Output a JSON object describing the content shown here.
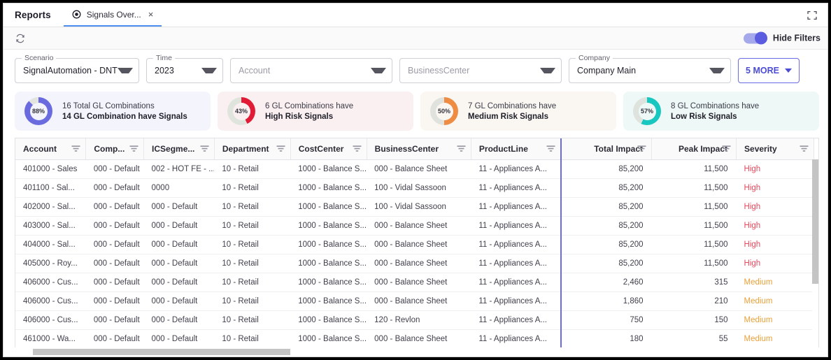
{
  "header": {
    "reports_title": "Reports",
    "tab_label": "Signals Over...",
    "tab_icon": "signal-dot-icon",
    "tab_close": "×",
    "expand_icon": "expand-fullscreen-icon"
  },
  "toolbar": {
    "refresh_icon": "refresh-icon",
    "hide_filters_label": "Hide Filters",
    "toggle_state": "on"
  },
  "filters": [
    {
      "legend": "Scenario",
      "value": "SignalAutomation - DNT",
      "placeholder": ""
    },
    {
      "legend": "Time",
      "value": "2023",
      "placeholder": ""
    },
    {
      "legend": "",
      "value": "",
      "placeholder": "Account"
    },
    {
      "legend": "",
      "value": "",
      "placeholder": "BusinessCenter"
    },
    {
      "legend": "Company",
      "value": "Company Main",
      "placeholder": ""
    }
  ],
  "more_button": {
    "label": "5 MORE"
  },
  "kpis": [
    {
      "percent": "88%",
      "pct_value": 88,
      "line1": "16 Total GL Combinations",
      "line2": "14 GL Combination have Signals",
      "bg": "#f4f4fd",
      "ring": "#6b6be0",
      "track": "#e2e4e0"
    },
    {
      "percent": "43%",
      "pct_value": 43,
      "line1": "6 GL Combinations have",
      "line2": "High Risk Signals",
      "bg": "#fbf0f1",
      "ring": "#e11b35",
      "track": "#dfe5dd"
    },
    {
      "percent": "50%",
      "pct_value": 50,
      "line1": "7 GL Combinations have",
      "line2": "Medium Risk Signals",
      "bg": "#faf7f2",
      "ring": "#ef8c43",
      "track": "#e0e3dd"
    },
    {
      "percent": "57%",
      "pct_value": 57,
      "line1": "8 GL Combinations have",
      "line2": "Low Risk Signals",
      "bg": "#eef8f7",
      "ring": "#17c7c0",
      "track": "#dfe3de"
    }
  ],
  "table": {
    "columns": [
      {
        "label": "Account",
        "align": "left",
        "width": 100
      },
      {
        "label": "Comp...",
        "align": "left",
        "width": 82
      },
      {
        "label": "ICSegme...",
        "align": "left",
        "width": 100
      },
      {
        "label": "Department",
        "align": "left",
        "width": 108
      },
      {
        "label": "CostCenter",
        "align": "left",
        "width": 108
      },
      {
        "label": "BusinessCenter",
        "align": "left",
        "width": 148
      },
      {
        "label": "ProductLine",
        "align": "left",
        "width": 128
      },
      {
        "label": "Total Impact",
        "align": "right",
        "width": 128
      },
      {
        "label": "Peak Impact",
        "align": "right",
        "width": 120
      },
      {
        "label": "Severity",
        "align": "left",
        "width": 110
      }
    ],
    "rows": [
      [
        "401000 - Sales",
        "000 - Default",
        "002 - HOT FE - ...",
        "10 - Retail",
        "1000 - Balance S...",
        "000 - Balance Sheet",
        "11 - Appliances A...",
        "85,200",
        "11,500",
        "High"
      ],
      [
        "401100 - Sal...",
        "000 - Default",
        "0000",
        "10 - Retail",
        "1000 - Balance S...",
        "100 - Vidal Sassoon",
        "11 - Appliances A...",
        "85,200",
        "11,500",
        "High"
      ],
      [
        "402000 - Sal...",
        "000 - Default",
        "000 - Default",
        "10 - Retail",
        "1000 - Balance S...",
        "100 - Vidal Sassoon",
        "11 - Appliances A...",
        "85,200",
        "11,500",
        "High"
      ],
      [
        "403000 - Sal...",
        "000 - Default",
        "000 - Default",
        "10 - Retail",
        "1000 - Balance S...",
        "000 - Balance Sheet",
        "11 - Appliances A...",
        "85,200",
        "11,500",
        "High"
      ],
      [
        "404000 - Sal...",
        "000 - Default",
        "000 - Default",
        "10 - Retail",
        "1000 - Balance S...",
        "000 - Balance Sheet",
        "11 - Appliances A...",
        "85,200",
        "11,500",
        "High"
      ],
      [
        "405000 - Roy...",
        "000 - Default",
        "000 - Default",
        "10 - Retail",
        "1000 - Balance S...",
        "000 - Balance Sheet",
        "11 - Appliances A...",
        "85,200",
        "11,500",
        "High"
      ],
      [
        "406000 - Cus...",
        "000 - Default",
        "000 - Default",
        "10 - Retail",
        "1000 - Balance S...",
        "000 - Balance Sheet",
        "11 - Appliances A...",
        "2,460",
        "315",
        "Medium"
      ],
      [
        "406000 - Cus...",
        "000 - Default",
        "000 - Default",
        "10 - Retail",
        "1000 - Balance S...",
        "000 - Balance Sheet",
        "11 - Appliances A...",
        "1,860",
        "210",
        "Medium"
      ],
      [
        "406000 - Cus...",
        "000 - Default",
        "000 - Default",
        "10 - Retail",
        "1000 - Balance S...",
        "120 - Revlon",
        "11 - Appliances A...",
        "750",
        "150",
        "Medium"
      ],
      [
        "461000 - Wa...",
        "000 - Default",
        "000 - Default",
        "10 - Retail",
        "1000 - Balance S...",
        "000 - Balance Sheet",
        "11 - Appliances A...",
        "180",
        "55",
        "Medium"
      ]
    ],
    "severity_column_index": 9,
    "divider_column_index": 7,
    "severity_colors": {
      "High": "#e8485c",
      "Medium": "#e8a13a"
    }
  }
}
